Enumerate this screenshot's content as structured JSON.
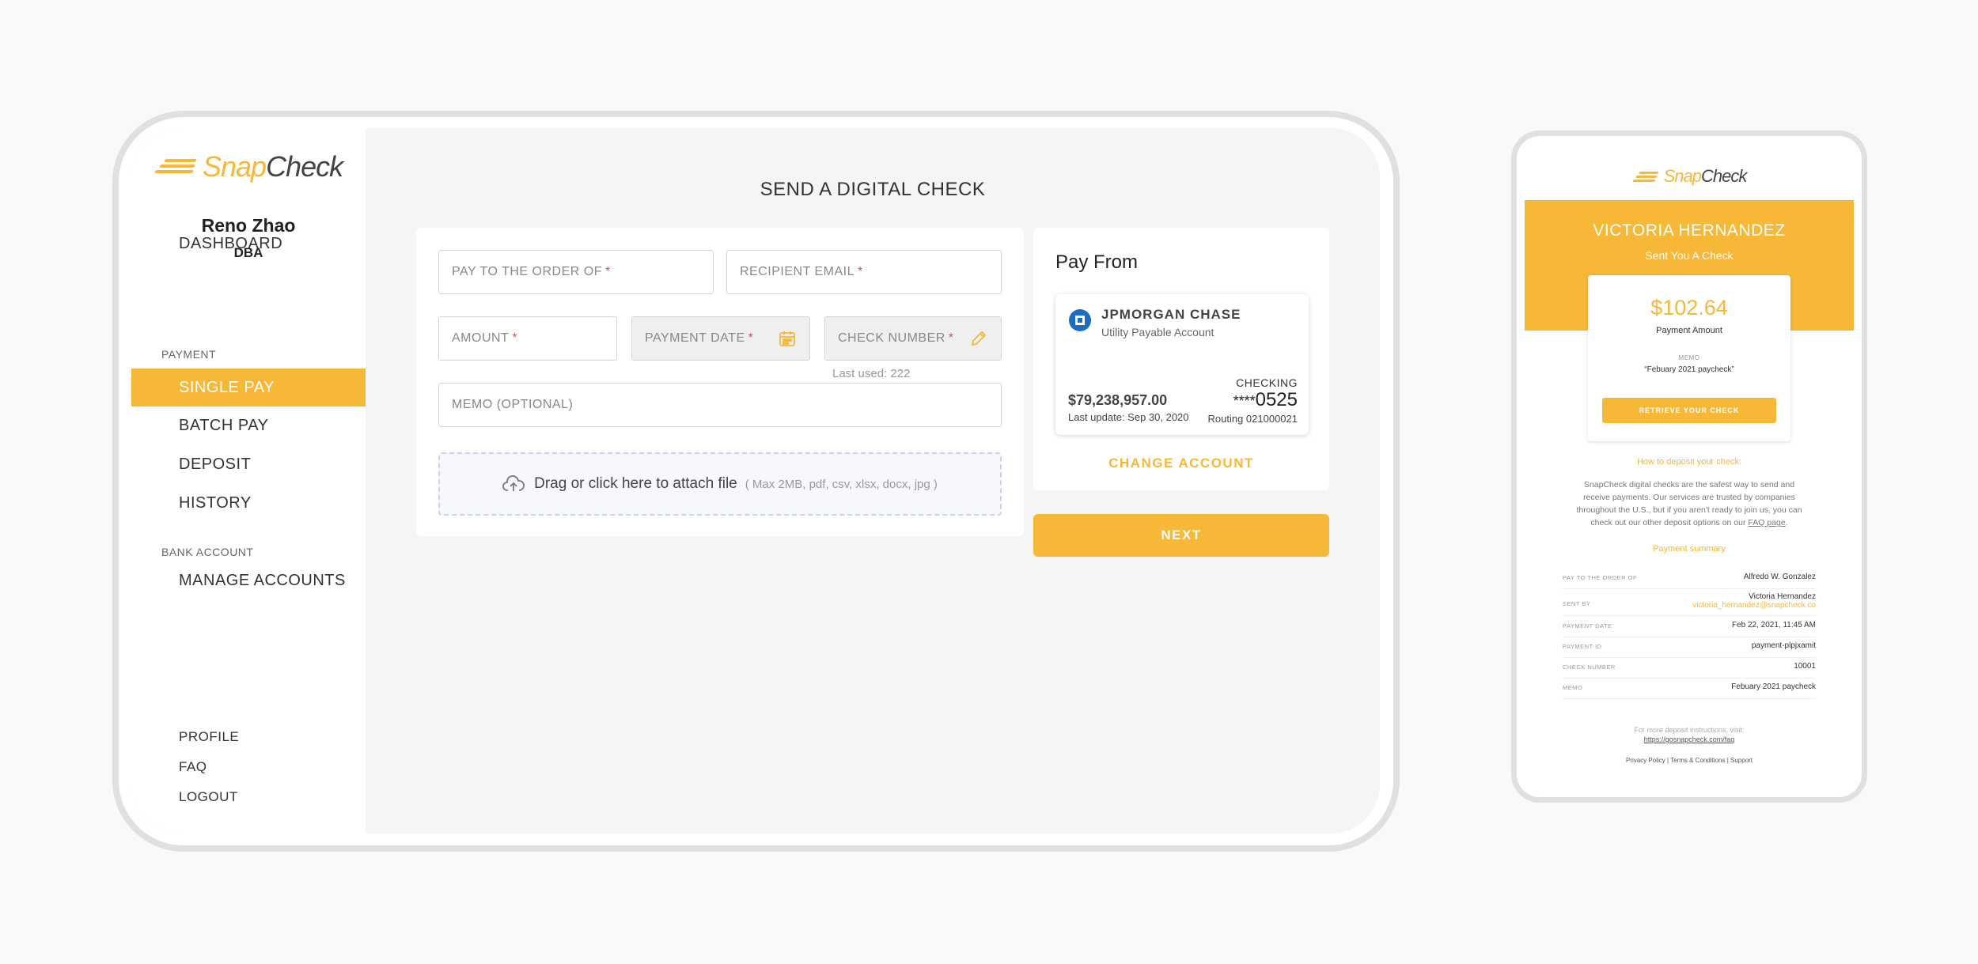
{
  "brand": {
    "part1": "Snap",
    "part2": "Check",
    "accent": "#f7b737"
  },
  "user": {
    "name": "Reno Zhao",
    "subtitle": "DBA"
  },
  "sidebar": {
    "dashboard": "DASHBOARD",
    "payment_section": "PAYMENT",
    "single_pay": "SINGLE PAY",
    "batch_pay": "BATCH PAY",
    "deposit": "DEPOSIT",
    "history": "HISTORY",
    "bank_section": "BANK ACCOUNT",
    "manage_accounts": "MANAGE ACCOUNTS",
    "profile": "PROFILE",
    "faq": "FAQ",
    "logout": "LOGOUT"
  },
  "page": {
    "title": "SEND A DIGITAL CHECK"
  },
  "form": {
    "pay_to": "PAY TO THE ORDER OF",
    "recipient_email": "RECIPIENT EMAIL",
    "amount": "AMOUNT",
    "payment_date": "PAYMENT DATE",
    "check_number": "CHECK NUMBER",
    "check_hint": "Last used: 222",
    "memo": "MEMO (OPTIONAL)",
    "required_mark": "*",
    "attach_text": "Drag or click here to attach file",
    "attach_hint": "( Max 2MB, pdf, csv, xlsx, docx, jpg )"
  },
  "pay_from": {
    "title": "Pay From",
    "bank_name": "JPMORGAN CHASE",
    "account_type": "Utility Payable Account",
    "balance": "$79,238,957.00",
    "last_update": "Last update: Sep 30, 2020",
    "kind": "CHECKING",
    "acct_mask": "****",
    "acct_last4": "0525",
    "routing": "Routing 021000021",
    "change_account": "CHANGE ACCOUNT"
  },
  "actions": {
    "next": "NEXT"
  },
  "email": {
    "sender": "VICTORIA HERNANDEZ",
    "sent_text": "Sent You A Check",
    "amount": "$102.64",
    "amount_label": "Payment Amount",
    "memo_label": "MEMO",
    "memo": "“Febuary 2021 paycheck”",
    "retrieve": "RETRIEVE YOUR CHECK",
    "howto": "How to deposit your check:",
    "desc": "SnapCheck digital checks are the safest way to send and receive payments. Our services are trusted by companies throughout the U.S., but if you aren't ready to join us, you can check out our other deposit options on our",
    "faq_link": "FAQ page",
    "summary_title": "Payment summary",
    "rows": [
      {
        "k": "PAY TO THE ORDER OF",
        "v": "Alfredo W. Gonzalez"
      },
      {
        "k": "SENT BY",
        "v": "Victoria Hernandez",
        "v2": "victoria_hernandez@snapcheck.co"
      },
      {
        "k": "PAYMENT DATE",
        "v": "Feb 22, 2021, 11:45 AM"
      },
      {
        "k": "PAYMENT ID",
        "v": "payment-plpjxamit"
      },
      {
        "k": "CHECK NUMBER",
        "v": "10001"
      },
      {
        "k": "MEMO",
        "v": "Febuary 2021 paycheck"
      }
    ],
    "footer_text": "For more deposit instructions, visit:",
    "footer_link": "https://gosnapcheck.com/faq",
    "footer_links": "Privacy Policy | Terms & Conditions | Support"
  }
}
